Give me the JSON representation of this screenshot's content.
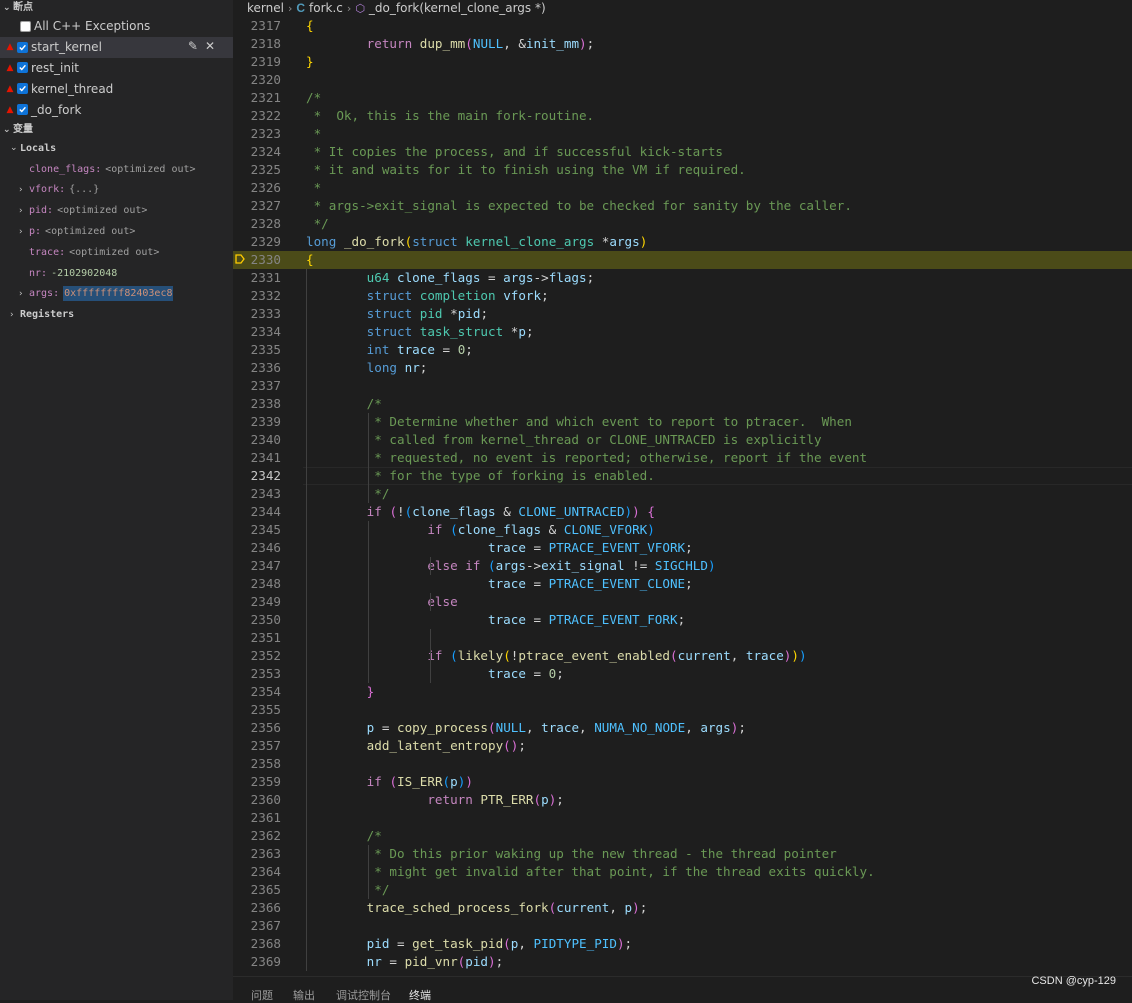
{
  "breakpoints": {
    "section_title": "断点",
    "all_exceptions_label": "All C++ Exceptions",
    "items": [
      {
        "label": "start_kernel",
        "checked": true
      },
      {
        "label": "rest_init",
        "checked": true
      },
      {
        "label": "kernel_thread",
        "checked": true
      },
      {
        "label": "_do_fork",
        "checked": true
      }
    ]
  },
  "variables": {
    "section_title": "变量",
    "locals_label": "Locals",
    "registers_label": "Registers",
    "items": [
      {
        "name": "clone_flags:",
        "value": "<optimized out>"
      },
      {
        "name": "vfork:",
        "value": "{...}"
      },
      {
        "name": "pid:",
        "value": "<optimized out>"
      },
      {
        "name": "p:",
        "value": "<optimized out>"
      },
      {
        "name": "trace:",
        "value": "<optimized out>"
      },
      {
        "name": "nr:",
        "value": "-2102902048"
      },
      {
        "name": "args:",
        "value": "0xffffffff82403ec8"
      }
    ]
  },
  "breadcrumb": {
    "folder": "kernel",
    "file_icon": "C",
    "file": "fork.c",
    "symbol": "_do_fork(kernel_clone_args *)"
  },
  "code": {
    "line_numbers": [
      "2317",
      "2318",
      "2319",
      "2320",
      "2321",
      "2322",
      "2323",
      "2324",
      "2325",
      "2326",
      "2327",
      "2328",
      "2329",
      "2330",
      "2331",
      "2332",
      "2333",
      "2334",
      "2335",
      "2336",
      "2337",
      "2338",
      "2339",
      "2340",
      "2341",
      "2342",
      "2343",
      "2344",
      "2345",
      "2346",
      "2347",
      "2348",
      "2349",
      "2350",
      "2351",
      "2352",
      "2353",
      "2354",
      "2355",
      "2356",
      "2357",
      "2358",
      "2359",
      "2360",
      "2361",
      "2362",
      "2363",
      "2364",
      "2365",
      "2366",
      "2367",
      "2368",
      "2369"
    ],
    "lines": [
      [
        [
          "br",
          "{"
        ]
      ],
      [
        [
          "t",
          "        "
        ],
        [
          "ctl",
          "return"
        ],
        [
          "t",
          " "
        ],
        [
          "fn",
          "dup_mm"
        ],
        [
          "br2",
          "("
        ],
        [
          "mac",
          "NULL"
        ],
        [
          "t",
          ", &"
        ],
        [
          "var",
          "init_mm"
        ],
        [
          "br2",
          ")"
        ],
        [
          "t",
          ";"
        ]
      ],
      [
        [
          "br",
          "}"
        ]
      ],
      [],
      [
        [
          "cm",
          "/*"
        ]
      ],
      [
        [
          "cm",
          " *  Ok, this is the main fork-routine."
        ]
      ],
      [
        [
          "cm",
          " *"
        ]
      ],
      [
        [
          "cm",
          " * It copies the process, and if successful kick-starts"
        ]
      ],
      [
        [
          "cm",
          " * it and waits for it to finish using the VM if required."
        ]
      ],
      [
        [
          "cm",
          " *"
        ]
      ],
      [
        [
          "cm",
          " * args->exit_signal is expected to be checked for sanity by the caller."
        ]
      ],
      [
        [
          "cm",
          " */"
        ]
      ],
      [
        [
          "kw",
          "long"
        ],
        [
          "t",
          " "
        ],
        [
          "fn",
          "_do_fork"
        ],
        [
          "br",
          "("
        ],
        [
          "kw",
          "struct"
        ],
        [
          "t",
          " "
        ],
        [
          "ty",
          "kernel_clone_args"
        ],
        [
          "t",
          " *"
        ],
        [
          "var",
          "args"
        ],
        [
          "br",
          ")"
        ]
      ],
      [
        [
          "br",
          "{"
        ]
      ],
      [
        [
          "t",
          "        "
        ],
        [
          "ty",
          "u64"
        ],
        [
          "t",
          " "
        ],
        [
          "var",
          "clone_flags"
        ],
        [
          "t",
          " = "
        ],
        [
          "var",
          "args"
        ],
        [
          "t",
          "->"
        ],
        [
          "var",
          "flags"
        ],
        [
          "t",
          ";"
        ]
      ],
      [
        [
          "t",
          "        "
        ],
        [
          "kw",
          "struct"
        ],
        [
          "t",
          " "
        ],
        [
          "ty",
          "completion"
        ],
        [
          "t",
          " "
        ],
        [
          "var",
          "vfork"
        ],
        [
          "t",
          ";"
        ]
      ],
      [
        [
          "t",
          "        "
        ],
        [
          "kw",
          "struct"
        ],
        [
          "t",
          " "
        ],
        [
          "ty",
          "pid"
        ],
        [
          "t",
          " *"
        ],
        [
          "var",
          "pid"
        ],
        [
          "t",
          ";"
        ]
      ],
      [
        [
          "t",
          "        "
        ],
        [
          "kw",
          "struct"
        ],
        [
          "t",
          " "
        ],
        [
          "ty",
          "task_struct"
        ],
        [
          "t",
          " *"
        ],
        [
          "var",
          "p"
        ],
        [
          "t",
          ";"
        ]
      ],
      [
        [
          "t",
          "        "
        ],
        [
          "kw",
          "int"
        ],
        [
          "t",
          " "
        ],
        [
          "var",
          "trace"
        ],
        [
          "t",
          " = "
        ],
        [
          "num",
          "0"
        ],
        [
          "t",
          ";"
        ]
      ],
      [
        [
          "t",
          "        "
        ],
        [
          "kw",
          "long"
        ],
        [
          "t",
          " "
        ],
        [
          "var",
          "nr"
        ],
        [
          "t",
          ";"
        ]
      ],
      [],
      [
        [
          "t",
          "        "
        ],
        [
          "cm",
          "/*"
        ]
      ],
      [
        [
          "t",
          "        "
        ],
        [
          "cm",
          " * Determine whether and which event to report to ptracer.  When"
        ]
      ],
      [
        [
          "t",
          "        "
        ],
        [
          "cm",
          " * called from kernel_thread or CLONE_UNTRACED is explicitly"
        ]
      ],
      [
        [
          "t",
          "        "
        ],
        [
          "cm",
          " * requested, no event is reported; otherwise, report if the event"
        ]
      ],
      [
        [
          "t",
          "        "
        ],
        [
          "cm",
          " * for the type of forking is enabled."
        ]
      ],
      [
        [
          "t",
          "        "
        ],
        [
          "cm",
          " */"
        ]
      ],
      [
        [
          "t",
          "        "
        ],
        [
          "ctl",
          "if"
        ],
        [
          "t",
          " "
        ],
        [
          "br2",
          "("
        ],
        [
          "t",
          "!"
        ],
        [
          "br3",
          "("
        ],
        [
          "var",
          "clone_flags"
        ],
        [
          "t",
          " & "
        ],
        [
          "mac",
          "CLONE_UNTRACED"
        ],
        [
          "br3",
          ")"
        ],
        [
          "br2",
          ")"
        ],
        [
          "t",
          " "
        ],
        [
          "br2",
          "{"
        ]
      ],
      [
        [
          "t",
          "                "
        ],
        [
          "ctl",
          "if"
        ],
        [
          "t",
          " "
        ],
        [
          "br3",
          "("
        ],
        [
          "var",
          "clone_flags"
        ],
        [
          "t",
          " & "
        ],
        [
          "mac",
          "CLONE_VFORK"
        ],
        [
          "br3",
          ")"
        ]
      ],
      [
        [
          "t",
          "                        "
        ],
        [
          "var",
          "trace"
        ],
        [
          "t",
          " = "
        ],
        [
          "mac",
          "PTRACE_EVENT_VFORK"
        ],
        [
          "t",
          ";"
        ]
      ],
      [
        [
          "t",
          "                "
        ],
        [
          "ctl",
          "else"
        ],
        [
          "t",
          " "
        ],
        [
          "ctl",
          "if"
        ],
        [
          "t",
          " "
        ],
        [
          "br3",
          "("
        ],
        [
          "var",
          "args"
        ],
        [
          "t",
          "->"
        ],
        [
          "var",
          "exit_signal"
        ],
        [
          "t",
          " != "
        ],
        [
          "mac",
          "SIGCHLD"
        ],
        [
          "br3",
          ")"
        ]
      ],
      [
        [
          "t",
          "                        "
        ],
        [
          "var",
          "trace"
        ],
        [
          "t",
          " = "
        ],
        [
          "mac",
          "PTRACE_EVENT_CLONE"
        ],
        [
          "t",
          ";"
        ]
      ],
      [
        [
          "t",
          "                "
        ],
        [
          "ctl",
          "else"
        ]
      ],
      [
        [
          "t",
          "                        "
        ],
        [
          "var",
          "trace"
        ],
        [
          "t",
          " = "
        ],
        [
          "mac",
          "PTRACE_EVENT_FORK"
        ],
        [
          "t",
          ";"
        ]
      ],
      [],
      [
        [
          "t",
          "                "
        ],
        [
          "ctl",
          "if"
        ],
        [
          "t",
          " "
        ],
        [
          "br3",
          "("
        ],
        [
          "fn",
          "likely"
        ],
        [
          "br",
          "("
        ],
        [
          "t",
          "!"
        ],
        [
          "fn",
          "ptrace_event_enabled"
        ],
        [
          "br2",
          "("
        ],
        [
          "var",
          "current"
        ],
        [
          "t",
          ", "
        ],
        [
          "var",
          "trace"
        ],
        [
          "br2",
          ")"
        ],
        [
          "br",
          ")"
        ],
        [
          "br3",
          ")"
        ]
      ],
      [
        [
          "t",
          "                        "
        ],
        [
          "var",
          "trace"
        ],
        [
          "t",
          " = "
        ],
        [
          "num",
          "0"
        ],
        [
          "t",
          ";"
        ]
      ],
      [
        [
          "t",
          "        "
        ],
        [
          "br2",
          "}"
        ]
      ],
      [],
      [
        [
          "t",
          "        "
        ],
        [
          "var",
          "p"
        ],
        [
          "t",
          " = "
        ],
        [
          "fn",
          "copy_process"
        ],
        [
          "br2",
          "("
        ],
        [
          "mac",
          "NULL"
        ],
        [
          "t",
          ", "
        ],
        [
          "var",
          "trace"
        ],
        [
          "t",
          ", "
        ],
        [
          "mac",
          "NUMA_NO_NODE"
        ],
        [
          "t",
          ", "
        ],
        [
          "var",
          "args"
        ],
        [
          "br2",
          ")"
        ],
        [
          "t",
          ";"
        ]
      ],
      [
        [
          "t",
          "        "
        ],
        [
          "fn",
          "add_latent_entropy"
        ],
        [
          "br2",
          "()"
        ],
        [
          "t",
          ";"
        ]
      ],
      [],
      [
        [
          "t",
          "        "
        ],
        [
          "ctl",
          "if"
        ],
        [
          "t",
          " "
        ],
        [
          "br2",
          "("
        ],
        [
          "fn",
          "IS_ERR"
        ],
        [
          "br3",
          "("
        ],
        [
          "var",
          "p"
        ],
        [
          "br3",
          ")"
        ],
        [
          "br2",
          ")"
        ]
      ],
      [
        [
          "t",
          "                "
        ],
        [
          "ctl",
          "return"
        ],
        [
          "t",
          " "
        ],
        [
          "fn",
          "PTR_ERR"
        ],
        [
          "br2",
          "("
        ],
        [
          "var",
          "p"
        ],
        [
          "br2",
          ")"
        ],
        [
          "t",
          ";"
        ]
      ],
      [],
      [
        [
          "t",
          "        "
        ],
        [
          "cm",
          "/*"
        ]
      ],
      [
        [
          "t",
          "        "
        ],
        [
          "cm",
          " * Do this prior waking up the new thread - the thread pointer"
        ]
      ],
      [
        [
          "t",
          "        "
        ],
        [
          "cm",
          " * might get invalid after that point, if the thread exits quickly."
        ]
      ],
      [
        [
          "t",
          "        "
        ],
        [
          "cm",
          " */"
        ]
      ],
      [
        [
          "t",
          "        "
        ],
        [
          "fn",
          "trace_sched_process_fork"
        ],
        [
          "br2",
          "("
        ],
        [
          "var",
          "current"
        ],
        [
          "t",
          ", "
        ],
        [
          "var",
          "p"
        ],
        [
          "br2",
          ")"
        ],
        [
          "t",
          ";"
        ]
      ],
      [],
      [
        [
          "t",
          "        "
        ],
        [
          "var",
          "pid"
        ],
        [
          "t",
          " = "
        ],
        [
          "fn",
          "get_task_pid"
        ],
        [
          "br2",
          "("
        ],
        [
          "var",
          "p"
        ],
        [
          "t",
          ", "
        ],
        [
          "mac",
          "PIDTYPE_PID"
        ],
        [
          "br2",
          ")"
        ],
        [
          "t",
          ";"
        ]
      ],
      [
        [
          "t",
          "        "
        ],
        [
          "var",
          "nr"
        ],
        [
          "t",
          " = "
        ],
        [
          "fn",
          "pid_vnr"
        ],
        [
          "br2",
          "("
        ],
        [
          "var",
          "pid"
        ],
        [
          "br2",
          ")"
        ],
        [
          "t",
          ";"
        ]
      ]
    ]
  },
  "panel": {
    "tabs": [
      "问题",
      "输出",
      "调试控制台",
      "终端"
    ],
    "active_tab": "终端"
  },
  "watermark": "CSDN @cyp-129",
  "colors": {
    "stopped_line": "#4b4b18",
    "breakpoint": "#e51400",
    "checkbox": "#0e73d8"
  }
}
